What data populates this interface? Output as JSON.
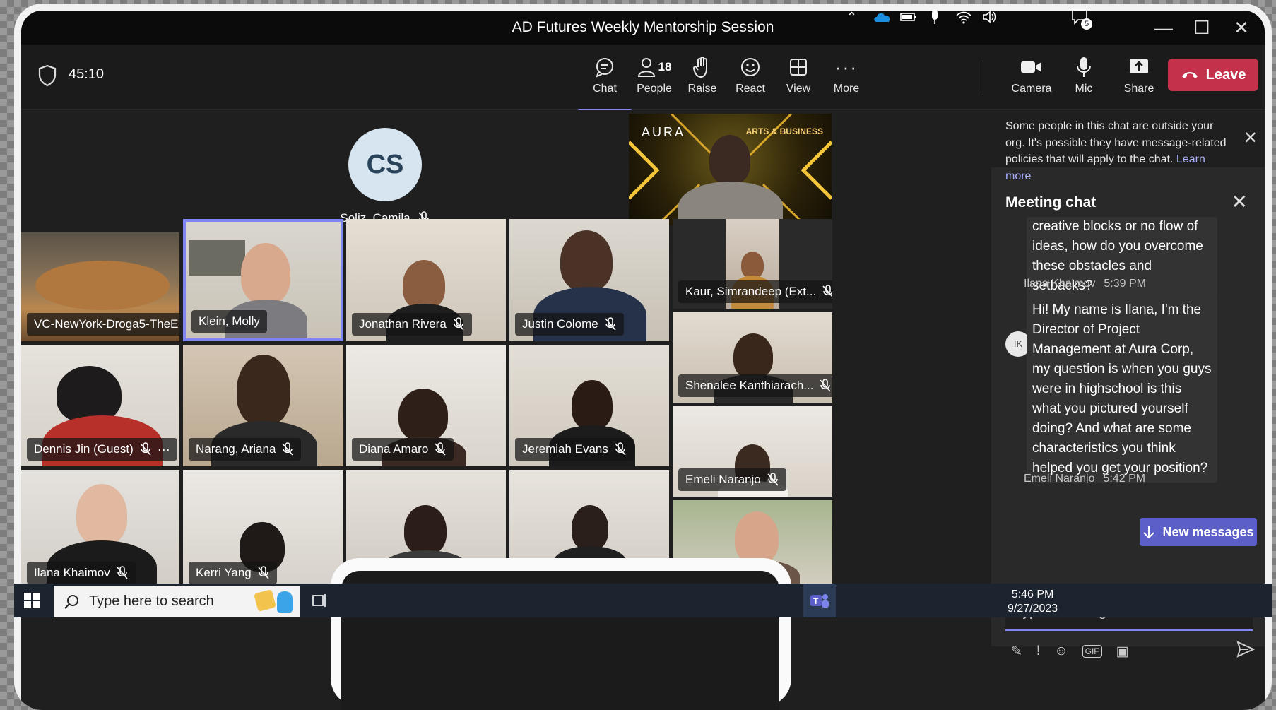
{
  "window": {
    "title": "AD Futures Weekly Mentorship Session"
  },
  "toolbar": {
    "timer": "45:10",
    "buttons": [
      {
        "label": "Chat",
        "icon": "chat-icon"
      },
      {
        "label": "People",
        "icon": "people-icon",
        "count": "18"
      },
      {
        "label": "Raise",
        "icon": "raise-hand-icon"
      },
      {
        "label": "React",
        "icon": "smiley-icon"
      },
      {
        "label": "View",
        "icon": "view-icon"
      },
      {
        "label": "More",
        "icon": "more-icon"
      },
      {
        "label": "Camera",
        "icon": "camera-icon"
      },
      {
        "label": "Mic",
        "icon": "mic-icon"
      },
      {
        "label": "Share",
        "icon": "share-icon"
      }
    ],
    "leave": "Leave"
  },
  "stage": {
    "featured": {
      "initials": "CS",
      "name": "Soliz, Camila"
    },
    "presenter_banner": {
      "brand": "AURA",
      "tag": "ARTS & BUSINESS"
    },
    "tiles": [
      {
        "name": "VC-NewYork-Droga5-TheE..."
      },
      {
        "name": "Klein, Molly"
      },
      {
        "name": "Jonathan Rivera"
      },
      {
        "name": "Justin Colome"
      },
      {
        "name": "Kaur, Simrandeep (Ext..."
      },
      {
        "name": "Dennis Jin (Guest)"
      },
      {
        "name": "Narang, Ariana"
      },
      {
        "name": "Diana Amaro"
      },
      {
        "name": "Jeremiah Evans"
      },
      {
        "name": "Shenalee Kanthiarach..."
      },
      {
        "name": "Emeli Naranjo"
      },
      {
        "name": "Ilana Khaimov"
      },
      {
        "name": "Kerri Yang"
      }
    ]
  },
  "panel": {
    "notice": "Some people in this chat are outside your org. It's possible they have message-related policies that will apply to the chat.",
    "notice_link": "Learn more",
    "title": "Meeting chat",
    "messages": [
      {
        "text": "creative blocks or no flow of ideas, how do you overcome these obstacles and setbacks?"
      },
      {
        "author": "Ilana Khaimov",
        "time": "5:39 PM",
        "initials": "IK",
        "text": "Hi! My name is Ilana, I'm the Director of Project Management at Aura Corp, my question is when you guys were in highschool is this what you pictured yourself doing? And what are some characteristics you think helped you get your position?"
      },
      {
        "author": "Emeli Naranjo",
        "time": "5:42 PM"
      }
    ],
    "new_messages": "New messages",
    "compose_placeholder": "Type a message..."
  },
  "taskbar": {
    "search_placeholder": "Type here to search",
    "time": "5:46 PM",
    "date": "9/27/2023",
    "notifications": "5"
  },
  "colors": {
    "accent": "#5b5fc7",
    "leave": "#c4314b",
    "highlight": "#7f85f5"
  }
}
